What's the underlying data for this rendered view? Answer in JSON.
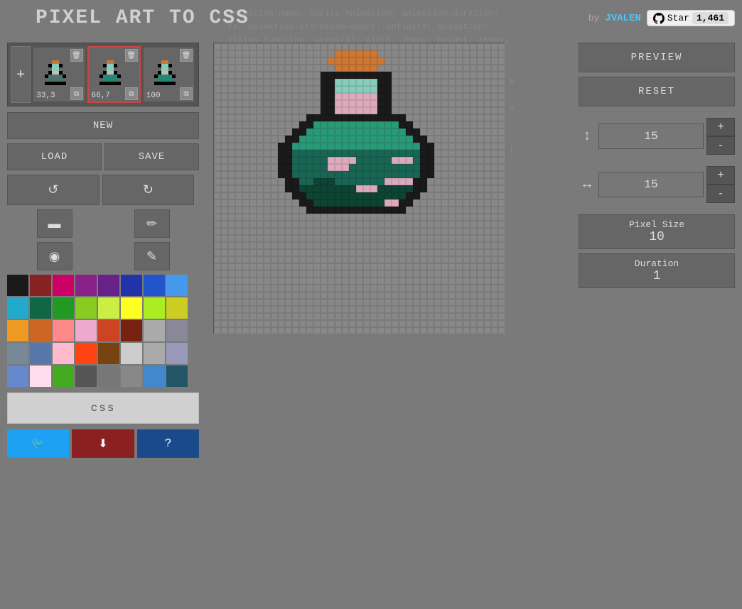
{
  "app": {
    "title": "PIXEL ART TO CSS",
    "author_prefix": "by",
    "author": "JVALEN",
    "star_label": "Star",
    "star_count": "1,461"
  },
  "frames": [
    {
      "id": 1,
      "label": "33,3",
      "active": false
    },
    {
      "id": 2,
      "label": "66,7",
      "active": true
    },
    {
      "id": 3,
      "label": "100",
      "active": false
    }
  ],
  "buttons": {
    "new": "NEW",
    "load": "LOAD",
    "save": "SAVE",
    "css": "css",
    "preview": "PREVIEW",
    "reset": "RESET"
  },
  "dimensions": {
    "height_value": "15",
    "width_value": "15",
    "plus_label": "+",
    "minus_label": "-"
  },
  "pixel_size": {
    "label": "Pixel Size",
    "value": "10"
  },
  "duration": {
    "label": "Duration",
    "value": "1"
  },
  "colors": [
    "#1a1a1a",
    "#882222",
    "#cc0066",
    "#882288",
    "#662288",
    "#2233aa",
    "#2255cc",
    "#4499ee",
    "#22aacc",
    "#116644",
    "#229922",
    "#88cc22",
    "#ccee44",
    "#ffff22",
    "#aaee22",
    "#cccc22",
    "#ee9922",
    "#cc6622",
    "#ff8888",
    "#eeaacc",
    "#cc4422",
    "#772211",
    "#aaaaaa",
    "#888899",
    "#778899",
    "#5577aa",
    "#ffbbcc",
    "#ff4411",
    "#774411",
    "#cccccc",
    "#aaaaaa",
    "#9999bb",
    "#6688cc",
    "#ffddee",
    "#44aa22",
    "#555555",
    "#777777",
    "#888888",
    "#4488cc",
    "#225566"
  ],
  "canvas": {
    "cols": 41,
    "rows": 41,
    "cell_size": 10
  },
  "icons": {
    "undo": "↺",
    "redo": "↻",
    "eraser": "▬",
    "eyedropper": "✏",
    "bucket": "◉",
    "brush": "✎",
    "twitter": "🐦",
    "download": "⬇",
    "help": "?"
  }
}
